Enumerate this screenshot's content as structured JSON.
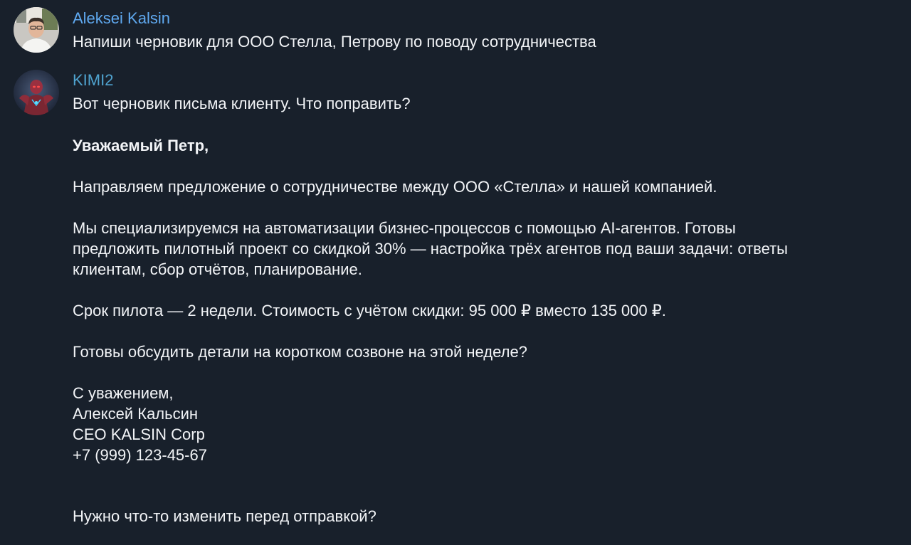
{
  "messages": [
    {
      "sender": "Aleksei Kalsin",
      "text": "Напиши черновик для ООО Стелла, Петрову по поводу сотрудничества"
    },
    {
      "sender": "KIMI2",
      "intro": "Вот черновик письма клиенту. Что поправить?",
      "greeting": "Уважаемый Петр,",
      "paragraph1": "Направляем предложение о сотрудничестве между ООО «Стелла» и нашей компанией.",
      "paragraph2_lines": [
        "Мы специализируемся на автоматизации бизнес-процессов с помощью AI-агентов. Готовы",
        "предложить пилотный проект со скидкой 30% — настройка трёх агентов под ваши задачи: ответы",
        "клиентам, сбор отчётов, планирование."
      ],
      "paragraph3": "Срок пилота — 2 недели. Стоимость с учётом скидки: 95 000 ₽ вместо 135 000 ₽.",
      "paragraph4": "Готовы обсудить детали на коротком созвоне на этой неделе?",
      "signature": [
        "С уважением,",
        "Алексей Кальсин",
        "CEO KALSIN Corp",
        "+7 (999) 123-45-67"
      ],
      "closing": "Нужно что-то изменить перед отправкой?"
    }
  ],
  "icons": {
    "user_avatar": "user-photo-avatar",
    "bot_avatar": "robot-avatar"
  },
  "colors": {
    "background": "#18202b",
    "user_name": "#5fa9f0",
    "bot_name": "#4fa3cf",
    "text": "#f2f4f7"
  }
}
